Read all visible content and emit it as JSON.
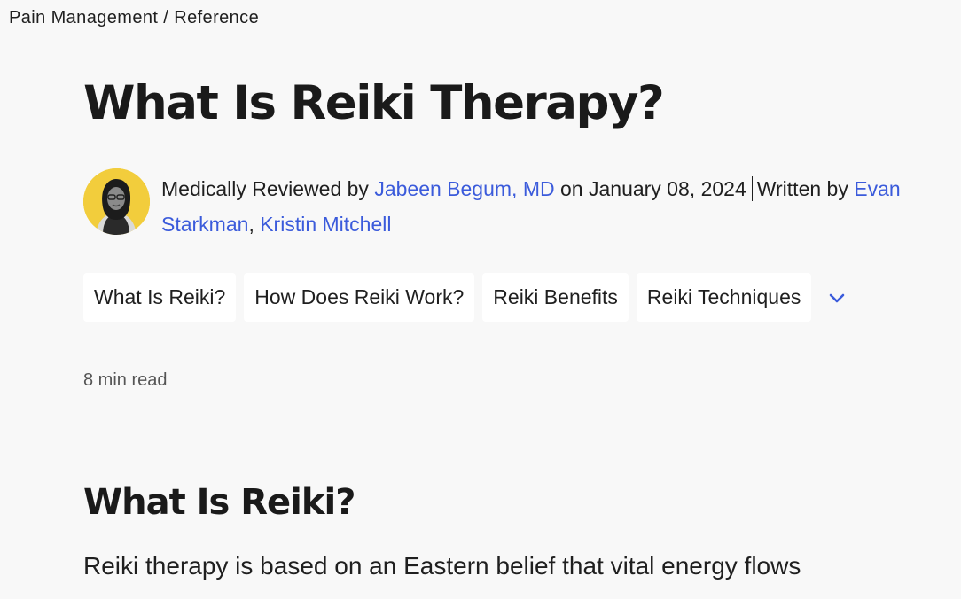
{
  "breadcrumb": {
    "parent": "Pain Management",
    "separator": "/",
    "current": "Reference"
  },
  "article": {
    "title": "What Is Reiki Therapy?",
    "byline": {
      "reviewed_prefix": "Medically Reviewed by",
      "reviewer": "Jabeen Begum, MD",
      "date_prefix": "on",
      "date": "January 08, 2024",
      "written_prefix": "Written by",
      "author1": "Evan Starkman",
      "author_separator": ",",
      "author2": "Kristin Mitchell"
    },
    "toc": [
      {
        "label": "What Is Reiki?"
      },
      {
        "label": "How Does Reiki Work?"
      },
      {
        "label": "Reiki Benefits"
      },
      {
        "label": "Reiki Techniques"
      }
    ],
    "toc_more_icon": "chevron-down-icon",
    "read_time": "8 min read",
    "section": {
      "heading": "What Is Reiki?",
      "body": "Reiki therapy is based on an Eastern belief that vital energy flows"
    }
  },
  "colors": {
    "link": "#3b5bdb",
    "background": "#f8f8f8",
    "avatar_bg": "#f2cd3c"
  }
}
